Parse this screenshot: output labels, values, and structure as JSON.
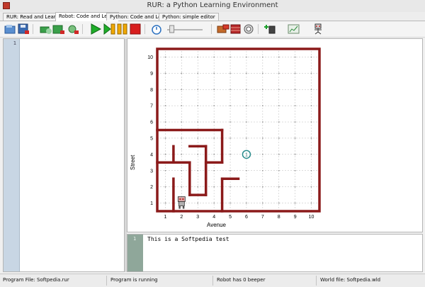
{
  "window": {
    "title": "RUR: a Python Learning Environment"
  },
  "tabs": [
    {
      "label": "RUR: Read and Learn"
    },
    {
      "label": "Robot: Code and Learn"
    },
    {
      "label": "Python: Code and Learn"
    },
    {
      "label": "Python: simple editor"
    }
  ],
  "toolbar": {
    "icons": [
      "open-program-icon",
      "save-program-icon",
      "open-world-icon",
      "save-world-icon",
      "reset-world-icon",
      "run-icon",
      "step-icon",
      "pause-icon",
      "stop-icon",
      "speed-icon",
      "speed-slider",
      "world-builder-icon",
      "edit-walls-icon",
      "beeper-icon",
      "add-beeper-icon",
      "robot-trace-icon",
      "add-robot-icon"
    ],
    "speed_level": 0.1
  },
  "editor": {
    "line_numbers": [
      "1"
    ],
    "code": ""
  },
  "world": {
    "xlabel": "Avenue",
    "ylabel": "Street",
    "avenues": [
      "1",
      "2",
      "3",
      "4",
      "5",
      "6",
      "7",
      "8",
      "9",
      "10"
    ],
    "streets": [
      "1",
      "2",
      "3",
      "4",
      "5",
      "6",
      "7",
      "8",
      "9",
      "10"
    ],
    "beeper": {
      "avenue": 6,
      "street": 4,
      "count": "1"
    },
    "robot": {
      "avenue": 2,
      "street": 1,
      "facing": "east"
    },
    "walls": [
      [
        [
          0.5,
          5.5
        ],
        [
          4.5,
          5.5
        ]
      ],
      [
        [
          4.5,
          5.5
        ],
        [
          4.5,
          3.5
        ]
      ],
      [
        [
          4.5,
          3.5
        ],
        [
          3.5,
          3.5
        ]
      ],
      [
        [
          2.5,
          4.5
        ],
        [
          3.5,
          4.5
        ]
      ],
      [
        [
          3.5,
          4.5
        ],
        [
          3.5,
          2.5
        ]
      ],
      [
        [
          1.5,
          4.5
        ],
        [
          1.5,
          3.5
        ]
      ],
      [
        [
          0.5,
          3.5
        ],
        [
          2.5,
          3.5
        ]
      ],
      [
        [
          2.5,
          3.5
        ],
        [
          2.5,
          1.5
        ]
      ],
      [
        [
          2.5,
          1.5
        ],
        [
          3.5,
          1.5
        ]
      ],
      [
        [
          3.5,
          1.5
        ],
        [
          3.5,
          2.5
        ]
      ],
      [
        [
          1.5,
          2.5
        ],
        [
          1.5,
          0.5
        ]
      ],
      [
        [
          4.5,
          2.5
        ],
        [
          4.5,
          0.5
        ]
      ],
      [
        [
          4.5,
          2.5
        ],
        [
          5.5,
          2.5
        ]
      ],
      [
        [
          3.5,
          3.5
        ],
        [
          3.5,
          2.5
        ]
      ]
    ],
    "colors": {
      "wall": "#8b1a1a",
      "grid": "#bbbbbb",
      "beeper": "#2a8c8c"
    }
  },
  "output": {
    "line_numbers": [
      "1"
    ],
    "text": "This is a Softpedia test"
  },
  "status": {
    "program_file": "Program File: Softpedia.rur",
    "state": "Program is running",
    "beepers": "Robot has 0 beeper",
    "world_file": "World file: Softpedia.wld"
  }
}
